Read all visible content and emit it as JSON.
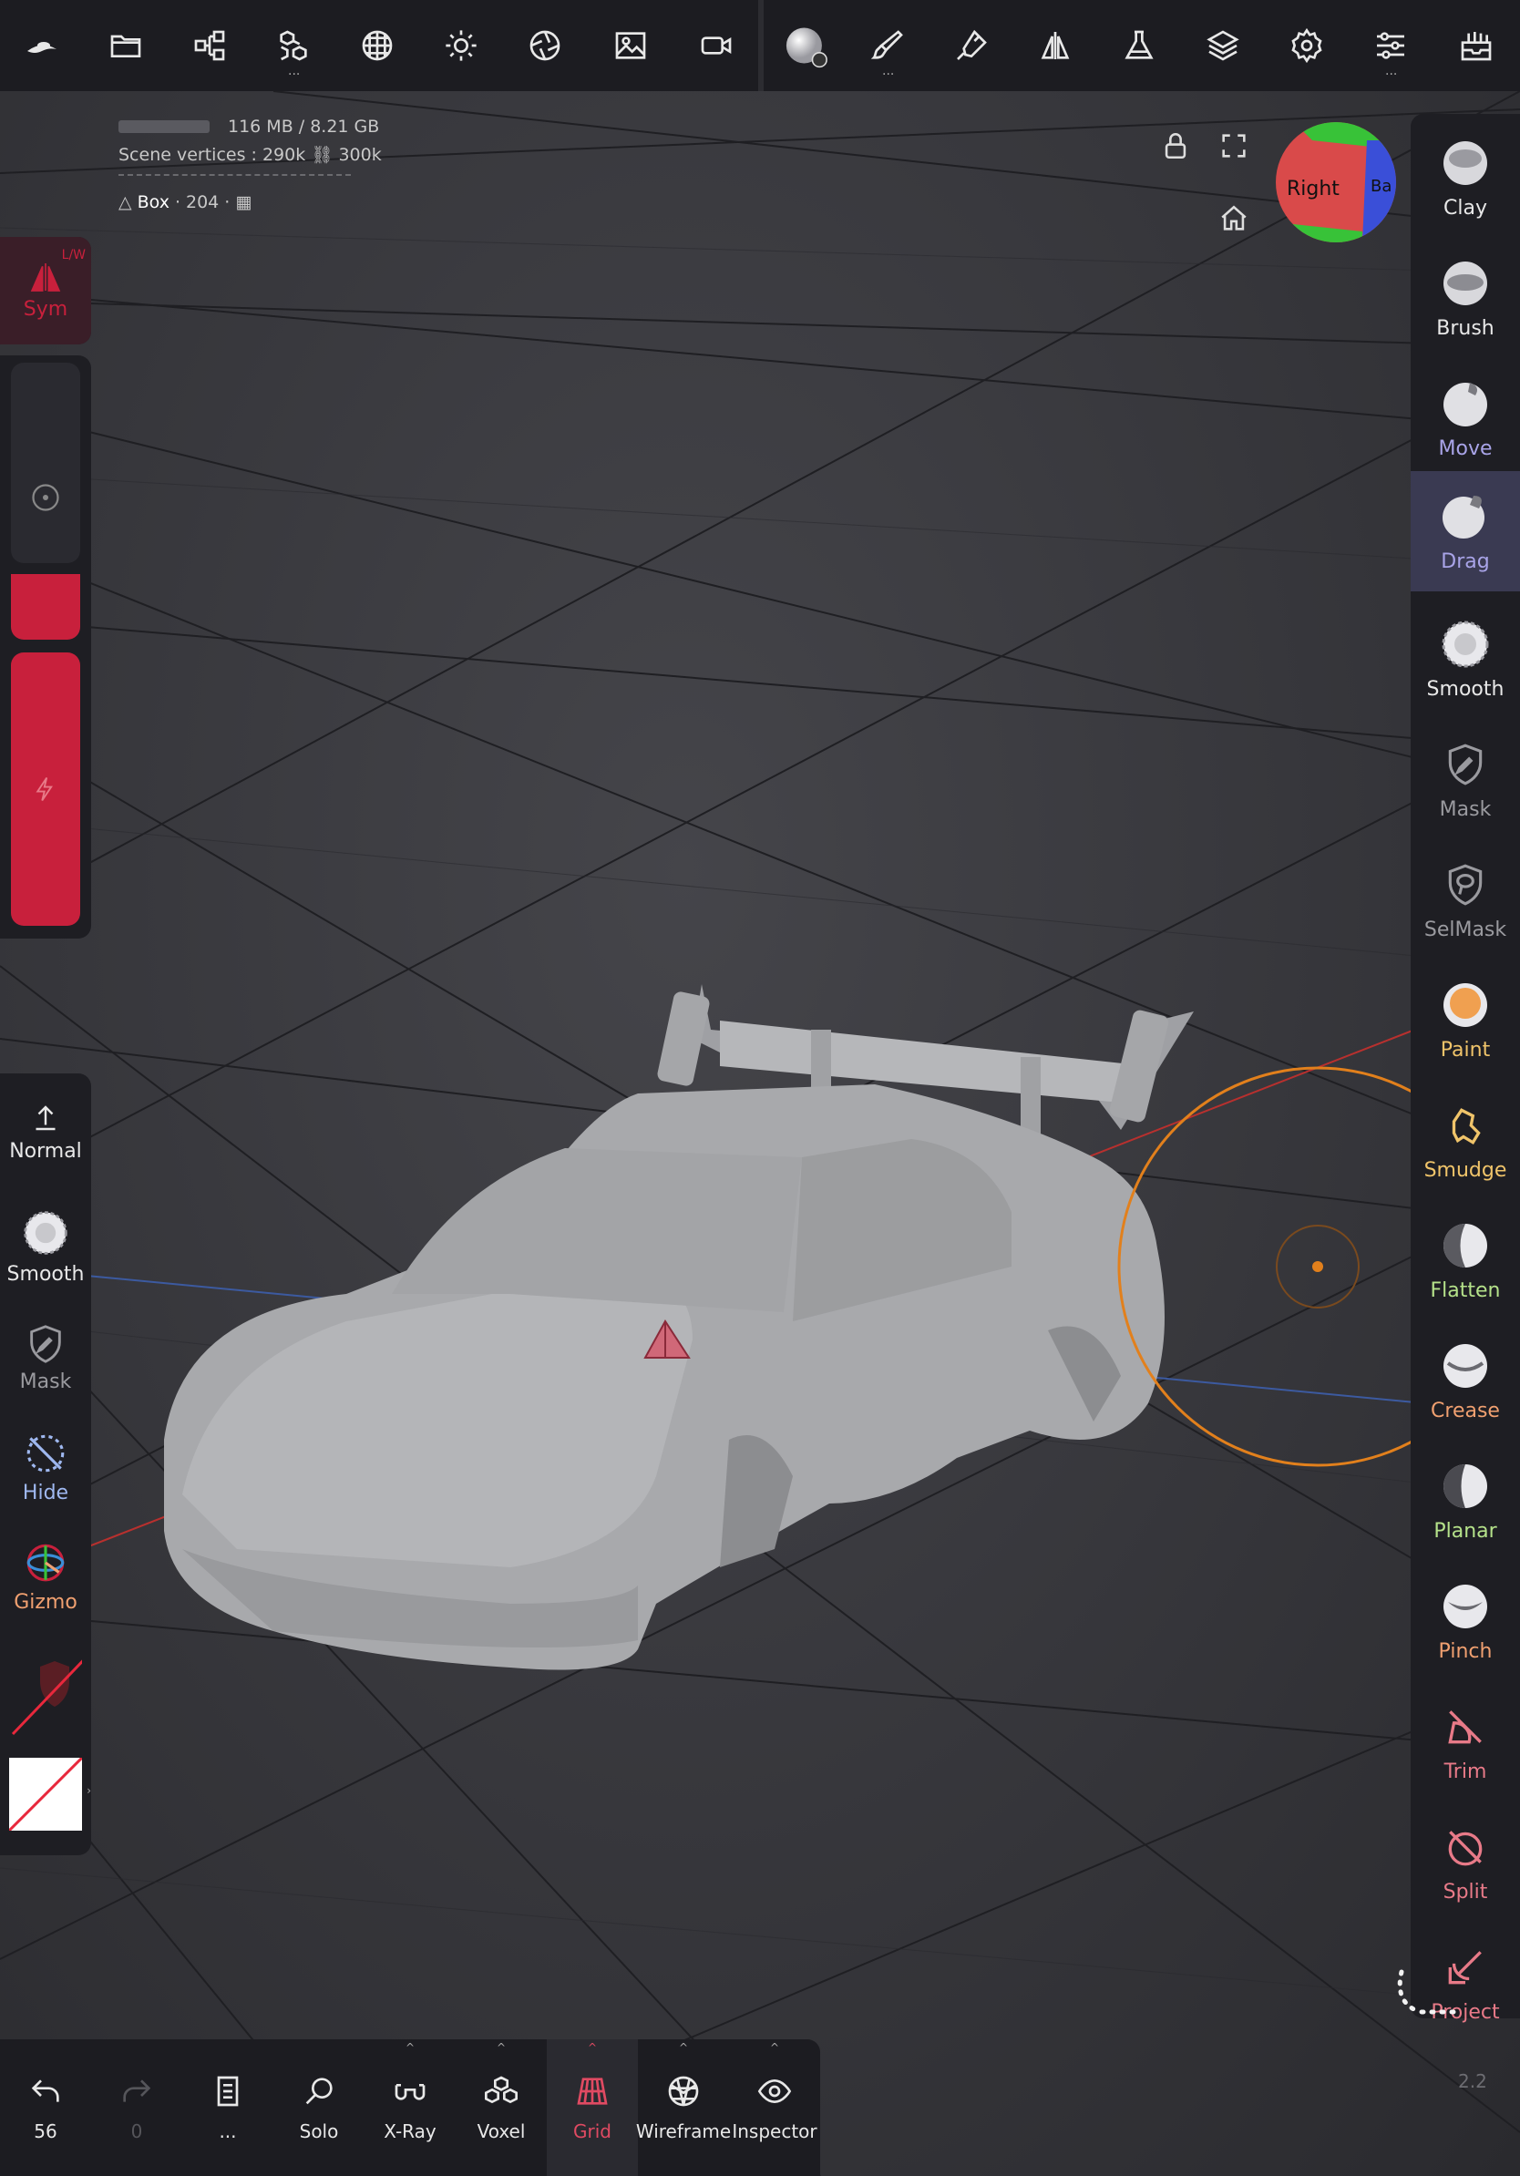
{
  "stats": {
    "memory": "116 MB / 8.21 GB",
    "scene_vertices_label": "Scene vertices :",
    "scene_vertices": "290k",
    "scene_faces": "300k",
    "object_name": "Box",
    "object_value": "204"
  },
  "view_cube": {
    "front": "Right",
    "side": "Ba"
  },
  "top_toolbar": {
    "icons": [
      "app-logo-icon",
      "folder-icon",
      "scene-share-icon",
      "multires-icon",
      "topology-icon",
      "light-icon",
      "camera-lens-icon",
      "background-image-icon",
      "video-icon",
      "material-sphere-icon",
      "paint-brush-icon",
      "stroke-pen-icon",
      "symmetry-icon",
      "flask-icon",
      "layers-icon",
      "settings-icon",
      "sliders-icon",
      "inbox-icon"
    ]
  },
  "right_tools": [
    {
      "label": "Clay",
      "color": "#e8e8e8",
      "icon": "clay-sphere-icon"
    },
    {
      "label": "Brush",
      "color": "#e8e8e8",
      "icon": "brush-sphere-icon"
    },
    {
      "label": "Move",
      "color": "#a9a4e8",
      "icon": "move-sphere-icon"
    },
    {
      "label": "Drag",
      "color": "#a9a4e8",
      "icon": "drag-sphere-icon",
      "active": true
    },
    {
      "label": "Smooth",
      "color": "#e8e8e8",
      "icon": "smooth-sphere-icon"
    },
    {
      "label": "Mask",
      "color": "#9a9a9f",
      "icon": "mask-shield-icon"
    },
    {
      "label": "SelMask",
      "color": "#9a9a9f",
      "icon": "selmask-shield-icon"
    },
    {
      "label": "Paint",
      "color": "#f0c46a",
      "icon": "paint-sphere-icon"
    },
    {
      "label": "Smudge",
      "color": "#f0c46a",
      "icon": "smudge-icon"
    },
    {
      "label": "Flatten",
      "color": "#b5e28a",
      "icon": "flatten-sphere-icon"
    },
    {
      "label": "Crease",
      "color": "#f0a070",
      "icon": "crease-sphere-icon"
    },
    {
      "label": "Planar",
      "color": "#b5e28a",
      "icon": "planar-sphere-icon"
    },
    {
      "label": "Pinch",
      "color": "#f0a070",
      "icon": "pinch-sphere-icon"
    },
    {
      "label": "Trim",
      "color": "#e87a88",
      "icon": "trim-icon"
    },
    {
      "label": "Split",
      "color": "#e87a88",
      "icon": "split-icon"
    },
    {
      "label": "Project",
      "color": "#e87a88",
      "icon": "project-icon"
    }
  ],
  "left_top": {
    "sym_label": "Sym",
    "sym_hint": "L/W"
  },
  "left_tools": [
    {
      "label": "Normal",
      "color": "#e8e8e8"
    },
    {
      "label": "Smooth",
      "color": "#e8e8e8"
    },
    {
      "label": "Mask",
      "color": "#9a9a9f"
    },
    {
      "label": "Hide",
      "color": "#9fb8f0"
    },
    {
      "label": "Gizmo",
      "color": "#f0a070"
    }
  ],
  "bottom_bar": {
    "undo_count": "56",
    "redo_count": "0",
    "menu_label": "...",
    "buttons": [
      "Solo",
      "X-Ray",
      "Voxel",
      "Grid",
      "Wireframe",
      "Inspector"
    ]
  },
  "colors": {
    "accent_red": "#c8203c",
    "active_grid": "#e04a62",
    "brush_ring": "#e2801c"
  },
  "version": "2.2"
}
